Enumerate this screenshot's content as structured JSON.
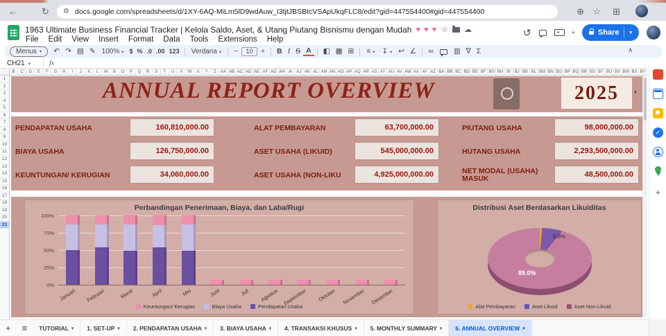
{
  "browser": {
    "url": "docs.google.com/spreadsheets/d/1XY-6AQ-MiLm5lD9wdAuw_I3tjtJBSBtcVSApUkqFLC8/edit?gid=447554400#gid=447554400",
    "icons": {
      "back": "←",
      "reload": "↻",
      "site_info": "⚙",
      "zoom": "⊕",
      "bookmark": "☆",
      "extensions": "⊞"
    }
  },
  "header": {
    "doc_title": "1963  Ultimate Business Financial Tracker | Kelola Saldo, Aset, & Utang Piutang Bisnismu dengan Mudah",
    "hearts": "♥ ♥ ♥",
    "title_icons": {
      "star": "☆",
      "cloud": "☁"
    },
    "menus": [
      "File",
      "Edit",
      "View",
      "Insert",
      "Format",
      "Data",
      "Tools",
      "Extensions",
      "Help"
    ],
    "history_icon": "↺",
    "share_label": "Share",
    "share_caret": "▾"
  },
  "toolbar": {
    "caret_glyph": "▾",
    "collapse_icon": "∧",
    "items": [
      {
        "kind": "pill",
        "name": "menus-button",
        "label": "Menus",
        "caret": true
      },
      {
        "kind": "icon",
        "name": "undo-icon",
        "glyph": "↶"
      },
      {
        "kind": "icon",
        "name": "redo-icon",
        "glyph": "↷"
      },
      {
        "kind": "icon",
        "name": "print-icon",
        "glyph": "▤"
      },
      {
        "kind": "icon",
        "name": "paint-format-icon",
        "glyph": "✎"
      },
      {
        "kind": "drop",
        "name": "zoom-select",
        "label": "100%",
        "caret": true
      },
      {
        "kind": "icon",
        "name": "format-currency-icon",
        "glyph": "$"
      },
      {
        "kind": "icon",
        "name": "format-percent-icon",
        "glyph": "%"
      },
      {
        "kind": "icon",
        "name": "decrease-decimal-icon",
        "glyph": ".0"
      },
      {
        "kind": "icon",
        "name": "increase-decimal-icon",
        "glyph": ".00"
      },
      {
        "kind": "icon",
        "name": "number-format-icon",
        "glyph": "123"
      },
      {
        "kind": "divider",
        "name": "toolbar-divider"
      },
      {
        "kind": "drop",
        "name": "font-select",
        "label": "Verdana",
        "caret": true
      },
      {
        "kind": "divider",
        "name": "toolbar-divider"
      },
      {
        "kind": "icon",
        "name": "decrease-font-size-icon",
        "glyph": "−"
      },
      {
        "kind": "box",
        "name": "font-size-input",
        "label": "10"
      },
      {
        "kind": "icon",
        "name": "increase-font-size-icon",
        "glyph": "+"
      },
      {
        "kind": "divider",
        "name": "toolbar-divider"
      },
      {
        "kind": "icon",
        "name": "bold-icon",
        "glyph": "B"
      },
      {
        "kind": "icon",
        "name": "italic-icon",
        "glyph": "I"
      },
      {
        "kind": "icon",
        "name": "strikethrough-icon",
        "glyph": "S"
      },
      {
        "kind": "icon",
        "name": "text-color-icon",
        "glyph": "A"
      },
      {
        "kind": "divider",
        "name": "toolbar-divider"
      },
      {
        "kind": "icon",
        "name": "fill-color-icon",
        "glyph": "◧"
      },
      {
        "kind": "icon",
        "name": "borders-icon",
        "glyph": "▦"
      },
      {
        "kind": "icon",
        "name": "merge-cells-icon",
        "glyph": "⊞"
      },
      {
        "kind": "divider",
        "name": "toolbar-divider"
      },
      {
        "kind": "drop",
        "name": "horizontal-align-icon",
        "label": "≡",
        "caret": true
      },
      {
        "kind": "drop",
        "name": "vertical-align-icon",
        "label": "↧",
        "caret": true
      },
      {
        "kind": "icon",
        "name": "text-wrap-icon",
        "glyph": "↩"
      },
      {
        "kind": "icon",
        "name": "text-rotation-icon",
        "glyph": "∠"
      },
      {
        "kind": "divider",
        "name": "toolbar-divider"
      },
      {
        "kind": "icon",
        "name": "insert-link-icon",
        "glyph": "∞"
      },
      {
        "kind": "bubble",
        "name": "insert-comment-icon"
      },
      {
        "kind": "icon",
        "name": "insert-chart-icon",
        "glyph": "▥"
      },
      {
        "kind": "icon",
        "name": "create-filter-icon",
        "glyph": "∇"
      },
      {
        "kind": "icon",
        "name": "functions-icon",
        "glyph": "Σ"
      }
    ]
  },
  "formula_bar": {
    "cell_ref": "CH21",
    "caret": "▾",
    "fx_label": "fx"
  },
  "sheet": {
    "columns": [
      "B",
      "C",
      "D",
      "E",
      "F",
      "G",
      "H",
      "I",
      "J",
      "K",
      "L",
      "M",
      "N",
      "O",
      "P",
      "Q",
      "R",
      "S",
      "T",
      "U",
      "V",
      "W",
      "X",
      "Y",
      "Z",
      "AA",
      "AB",
      "AC",
      "AD",
      "AE",
      "AF",
      "AG",
      "AH",
      "AI",
      "AJ",
      "AK",
      "AL",
      "AM",
      "AN",
      "AO",
      "AP",
      "AQ",
      "AR",
      "AS",
      "AT",
      "AU",
      "AV",
      "AW",
      "AX",
      "AY",
      "AZ",
      "BA",
      "BB",
      "BC",
      "BD",
      "BE",
      "BF",
      "BG",
      "BH",
      "BI",
      "BJ",
      "BK",
      "BL",
      "BM",
      "BN",
      "BO",
      "BP",
      "BQ",
      "BR",
      "BS",
      "BT",
      "BU",
      "BV",
      "BW",
      "BX",
      "BY"
    ],
    "rows": [
      "1",
      "2",
      "3",
      "4",
      "5",
      "6",
      "7",
      "8",
      "9",
      "10",
      "11",
      "12",
      "13",
      "14",
      "15",
      "16",
      "17",
      "18",
      "19",
      "20",
      "21"
    ],
    "selected_row": "21"
  },
  "dashboard": {
    "title": "ANNUAL REPORT OVERVIEW",
    "year": "2025",
    "year_caret": "▾",
    "metrics": [
      {
        "label": "PENDAPATAN USAHA",
        "value": "160,810,000.00"
      },
      {
        "label": "ALAT PEMBAYARAN",
        "value": "63,700,000.00"
      },
      {
        "label": "PIUTANG USAHA",
        "value": "98,000,000.00"
      },
      {
        "label": "BIAYA USAHA",
        "value": "126,750,000.00"
      },
      {
        "label": "ASET USAHA (LIKUID)",
        "value": "545,000,000.00"
      },
      {
        "label": "HUTANG USAHA",
        "value": "2,293,500,000.00"
      },
      {
        "label": "KEUNTUNGAN/ KERUGIAN",
        "value": "34,060,000.00"
      },
      {
        "label": "ASET USAHA (NON-LIKU",
        "value": "4,925,000,000.00"
      },
      {
        "label": "NET MODAL (USAHA) MASUK",
        "value": "48,500,000.00"
      }
    ],
    "colors": {
      "background": "#c69a92",
      "panel": "#d2aea7",
      "label": "#7a1d10",
      "value": "#9e1408",
      "value_box": "#ebe4de",
      "year_box": "#f4ece2",
      "title": "#8c2318"
    }
  },
  "chart_data": [
    {
      "type": "bar",
      "stacked_percent": true,
      "title": "Perbandingan Penerimaan, Biaya, dan Laba/Rugi",
      "categories": [
        "Januari",
        "Februari",
        "Maret",
        "April",
        "Mei",
        "Juni",
        "Juli",
        "Agustus",
        "September",
        "Oktober",
        "November",
        "Desember"
      ],
      "series": [
        {
          "name": "Pendapatan Usaha",
          "color": "#6b4fa1",
          "values": [
            50,
            54,
            49,
            54,
            49,
            0,
            0,
            0,
            0,
            0,
            0,
            0
          ]
        },
        {
          "name": "Biaya Usaha",
          "color": "#c8bfe4",
          "values": [
            37,
            33,
            38,
            32,
            38,
            0,
            0,
            0,
            0,
            0,
            0,
            0
          ]
        },
        {
          "name": "Keuntungan/ Kerugian",
          "color": "#ee8fab",
          "values": [
            13,
            13,
            13,
            14,
            13,
            7,
            7,
            7,
            7,
            7,
            7,
            7
          ]
        }
      ],
      "y_ticks": [
        "100%",
        "75%",
        "50%",
        "25%",
        "0%"
      ],
      "ylim": [
        0,
        100
      ],
      "legend": [
        {
          "label": "Keuntungan/ Kerugian",
          "color": "#ee8fab"
        },
        {
          "label": "Biaya Usaha",
          "color": "#c8bfe4"
        },
        {
          "label": "Pendapatan Usaha",
          "color": "#6b4fa1"
        }
      ]
    },
    {
      "type": "pie",
      "donut": true,
      "title": "Distribusi Aset Berdasarkan Likuiditas",
      "slices": [
        {
          "name": "Alat Pembayaran",
          "pct": 1.2,
          "color": "#eda23f",
          "legend_color": "#eda23f"
        },
        {
          "name": "Aset Likuid",
          "pct": 9.8,
          "color": "#7a5aa8",
          "legend_color": "#6455b8"
        },
        {
          "name": "Aset Non-Likuid",
          "pct": 89.0,
          "color": "#c67e9f",
          "legend_color": "#a0506f"
        }
      ],
      "labels": [
        "89.0%",
        "9.8%"
      ]
    }
  ],
  "side_rail": {
    "plus": "+",
    "tasks_check": "✓"
  },
  "tabs": {
    "add_icon": "+",
    "all_sheets_icon": "≡",
    "caret": "▾",
    "items": [
      {
        "label": "TUTORIAL",
        "active": false
      },
      {
        "label": "1. SET-UP",
        "active": false
      },
      {
        "label": "2. PENDAPATAN USAHA",
        "active": false
      },
      {
        "label": "3. BIAYA USAHA",
        "active": false
      },
      {
        "label": "4. TRANSAKSI KHUSUS",
        "active": false
      },
      {
        "label": "5. MONTHLY SUMMARY",
        "active": false
      },
      {
        "label": "6. ANNUAL OVERVIEW",
        "active": true
      }
    ]
  }
}
